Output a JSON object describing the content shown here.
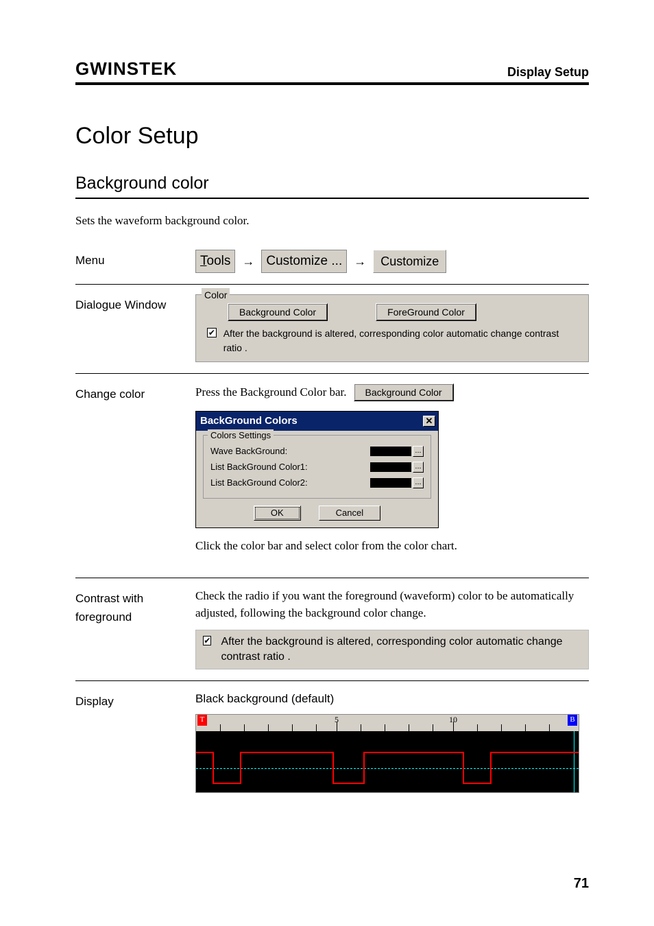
{
  "header": {
    "brand": "GWINSTEK",
    "title": "Display Setup"
  },
  "page_title": "Color Setup",
  "section_title": "Background color",
  "intro": "Sets the waveform background color.",
  "rows": {
    "menu": {
      "label": "Menu",
      "tools": "Tools",
      "customize_menu": "Customize ...",
      "customize_tab": "Customize",
      "arrow": "→"
    },
    "dialogue": {
      "label": "Dialogue Window",
      "group_legend": "Color",
      "btn_bg": "Background Color",
      "btn_fg": "ForeGround Color",
      "check_text": "After the background is altered, corresponding color automatic change contrast ratio ."
    },
    "change": {
      "label": "Change color",
      "press_text": "Press the Background Color bar.",
      "btn_bg": "Background Color",
      "dlg_title": "BackGround Colors",
      "dlg_group": "Colors Settings",
      "row1": "Wave BackGround:",
      "row2": "List BackGround Color1:",
      "row3": "List BackGround Color2:",
      "ok": "OK",
      "cancel": "Cancel",
      "after_text": "Click the color bar and select color from the color chart."
    },
    "contrast": {
      "label": "Contrast with foreground",
      "text": "Check the radio if you want the foreground (waveform) color to be automatically adjusted, following the background color change.",
      "check_text": "After the background is altered, corresponding color automatic change contrast ratio ."
    },
    "display": {
      "label": "Display",
      "title": "Black background (default)",
      "num5": "5",
      "num10": "10",
      "t": "T",
      "b": "B"
    }
  },
  "page_number": "71"
}
